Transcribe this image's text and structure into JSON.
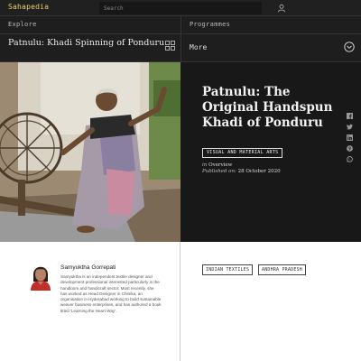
{
  "header": {
    "logo": "Sahapedia",
    "search_placeholder": "Search",
    "user_icon": "user-icon"
  },
  "nav": {
    "left": "Explore",
    "right": "Programmes"
  },
  "subheader": {
    "title": "Patnulu: Khadi Spinning of Ponduru",
    "grid_icon": "grid-icon",
    "more_label": "More",
    "more_icon": "chevron-down-circle-icon"
  },
  "hero": {
    "image_description": "woman-spinning-charkha",
    "title": "Patnulu: The Original Handspun Khadi of Ponduru",
    "category": "VISUAL AND MATERIAL ARTS",
    "in_prefix": "in",
    "section": "Overview",
    "published_prefix": "Published on:",
    "published_date": "28 October 2020"
  },
  "social": [
    "facebook-icon",
    "twitter-icon",
    "linkedin-icon",
    "pinterest-icon",
    "whatsapp-icon"
  ],
  "author": {
    "name": "Samyuktha Gorrepati",
    "bio": "Samyuktha is an independent textile designer and development professional interested particularly in the handloom and handicraft sector. Most recently, she has worked as Head Designer in Chitrika, an organisation in Hyderabad working to build sustainable weaver business enterprises, and has authored a book titled 'Learning the Heart Way'."
  },
  "tags": [
    "INDIAN TEXTILES",
    "ANDHRA PRADESH"
  ],
  "colors": {
    "logo": "#e6d36b",
    "dark_bg": "#1e1e1e",
    "hero_bg": "#181818",
    "bottom_bg": "#ffffff"
  }
}
